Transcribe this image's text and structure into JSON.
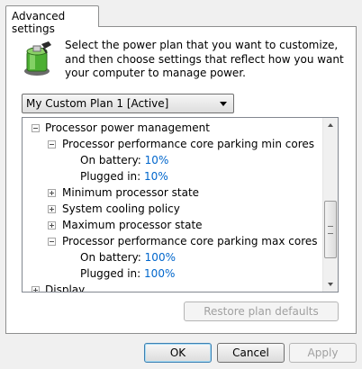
{
  "tab": {
    "label": "Advanced settings"
  },
  "intro": "Select the power plan that you want to customize, and then choose settings that reflect how you want your computer to manage power.",
  "plan_select": {
    "value": "My Custom Plan 1 [Active]"
  },
  "tree": {
    "processor_power_management": "Processor power management",
    "parking_min": {
      "label": "Processor performance core parking min cores",
      "on_battery_label": "On battery:",
      "on_battery_value": "10%",
      "plugged_in_label": "Plugged in:",
      "plugged_in_value": "10%"
    },
    "min_state": "Minimum processor state",
    "cooling_policy": "System cooling policy",
    "max_state": "Maximum processor state",
    "parking_max": {
      "label": "Processor performance core parking max cores",
      "on_battery_label": "On battery:",
      "on_battery_value": "100%",
      "plugged_in_label": "Plugged in:",
      "plugged_in_value": "100%"
    },
    "display": "Display"
  },
  "buttons": {
    "restore": "Restore plan defaults",
    "ok": "OK",
    "cancel": "Cancel",
    "apply": "Apply"
  },
  "colors": {
    "value_text": "#0066cc",
    "panel_bg": "#ffffff",
    "window_bg": "#f0f0f0"
  }
}
